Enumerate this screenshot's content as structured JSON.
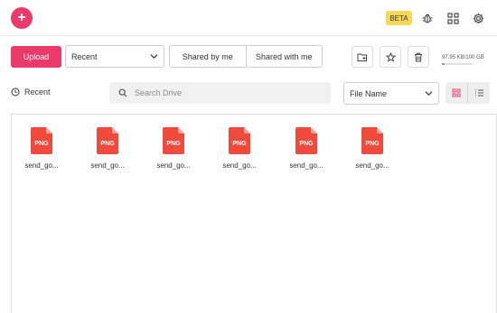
{
  "topbar": {
    "new_label": "+",
    "beta_label": "BETA",
    "icons": [
      "bug-icon",
      "apps-icon",
      "gear-icon"
    ]
  },
  "toolbar": {
    "upload_label": "Upload",
    "filter_value": "Recent",
    "segments": [
      "Shared by me",
      "Shared with me"
    ],
    "icons": [
      "new-folder-icon",
      "star-icon",
      "trash-icon"
    ],
    "storage_text": "97.95 KB/100 GB",
    "storage_fraction": 9.8e-07
  },
  "subbar": {
    "section_label": "Recent",
    "search_placeholder": "Search Drive",
    "sort_value": "File Name"
  },
  "files": [
    {
      "type_label": "PNG",
      "name": "send_go..."
    },
    {
      "type_label": "PNG",
      "name": "send_go..."
    },
    {
      "type_label": "PNG",
      "name": "send_go..."
    },
    {
      "type_label": "PNG",
      "name": "send_go..."
    },
    {
      "type_label": "PNG",
      "name": "send_go..."
    },
    {
      "type_label": "PNG",
      "name": "send_go..."
    }
  ],
  "colors": {
    "accent": "#ea3a6a",
    "file_icon": "#ef4a3c",
    "beta": "#f6d95a"
  }
}
